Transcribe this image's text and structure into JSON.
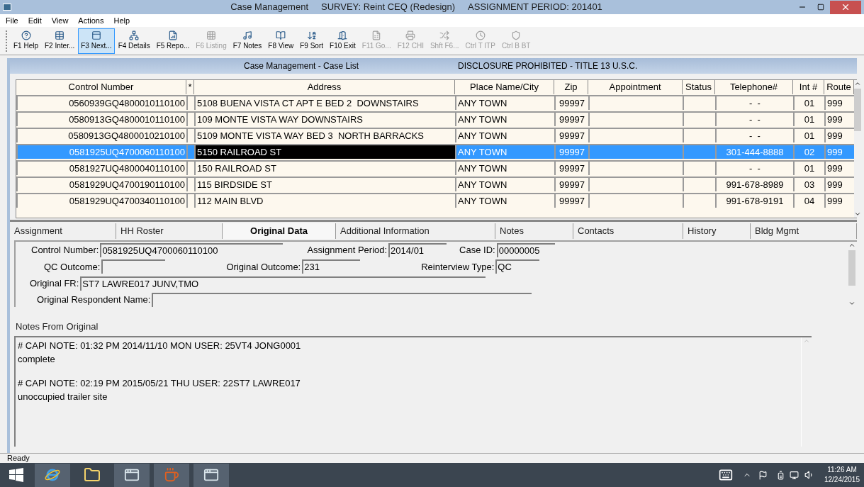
{
  "window": {
    "title_parts": [
      "Case Management",
      "SURVEY: Reint CEQ (Redesign)",
      "ASSIGNMENT PERIOD: 201401"
    ]
  },
  "menu": [
    "File",
    "Edit",
    "View",
    "Actions",
    "Help"
  ],
  "toolbar": [
    {
      "label": "F1 Help",
      "disabled": false,
      "selected": false
    },
    {
      "label": "F2 Inter...",
      "disabled": false,
      "selected": false
    },
    {
      "label": "F3 Next...",
      "disabled": false,
      "selected": true
    },
    {
      "label": "F4 Details",
      "disabled": false,
      "selected": false
    },
    {
      "label": "F5 Repo...",
      "disabled": false,
      "selected": false
    },
    {
      "label": "F6 Listing",
      "disabled": true,
      "selected": false
    },
    {
      "label": "F7 Notes",
      "disabled": false,
      "selected": false
    },
    {
      "label": "F8 View",
      "disabled": false,
      "selected": false
    },
    {
      "label": "F9 Sort",
      "disabled": false,
      "selected": false
    },
    {
      "label": "F10 Exit",
      "disabled": false,
      "selected": false
    },
    {
      "label": "F11 Go...",
      "disabled": true,
      "selected": false
    },
    {
      "label": "F12 CHI",
      "disabled": true,
      "selected": false
    },
    {
      "label": "Shft F6...",
      "disabled": true,
      "selected": false
    },
    {
      "label": "Ctrl T ITP",
      "disabled": true,
      "selected": false
    },
    {
      "label": "Ctrl B BT",
      "disabled": true,
      "selected": false
    }
  ],
  "case_list": {
    "title": "Case Management - Case List",
    "notice": "DISCLOSURE PROHIBITED - TITLE 13 U.S.C.",
    "columns": [
      "Control Number",
      "*",
      "Address",
      "Place Name/City",
      "Zip",
      "Appointment",
      "Status",
      "Telephone#",
      "Int #",
      "Route"
    ],
    "rows": [
      {
        "selected": false,
        "cells": [
          "0560939GQ4800010110100",
          "",
          "5108 BUENA VISTA CT APT E BED 2  DOWNSTAIRS",
          "ANY TOWN",
          "99997",
          "",
          "",
          "-  -",
          "01",
          "999"
        ]
      },
      {
        "selected": false,
        "cells": [
          "0580913GQ4800010110100",
          "",
          "109 MONTE VISTA WAY DOWNSTAIRS",
          "ANY TOWN",
          "99997",
          "",
          "",
          "-  -",
          "01",
          "999"
        ]
      },
      {
        "selected": false,
        "cells": [
          "0580913GQ4800010210100",
          "",
          "5109 MONTE VISTA WAY BED 3  NORTH BARRACKS",
          "ANY TOWN",
          "99997",
          "",
          "",
          "-  -",
          "01",
          "999"
        ]
      },
      {
        "selected": true,
        "cells": [
          "0581925UQ4700060110100",
          "",
          "5150 RAILROAD ST",
          "ANY TOWN",
          "99997",
          "",
          "",
          "301-444-8888",
          "02",
          "999"
        ]
      },
      {
        "selected": false,
        "cells": [
          "0581927UQ4800040110100",
          "",
          "150 RAILROAD ST",
          "ANY TOWN",
          "99997",
          "",
          "",
          "-  -",
          "01",
          "999"
        ]
      },
      {
        "selected": false,
        "cells": [
          "0581929UQ4700190110100",
          "",
          "115 BIRDSIDE ST",
          "ANY TOWN",
          "99997",
          "",
          "",
          "991-678-8989",
          "03",
          "999"
        ]
      },
      {
        "selected": false,
        "cells": [
          "0581929UQ4700340110100",
          "",
          "112 MAIN BLVD",
          "ANY TOWN",
          "99997",
          "",
          "",
          "991-678-9191",
          "04",
          "999"
        ]
      }
    ]
  },
  "tabs": [
    {
      "label": "Assignment",
      "selected": false
    },
    {
      "label": "HH Roster",
      "selected": false
    },
    {
      "label": "Original Data",
      "selected": true
    },
    {
      "label": "Additional Information",
      "selected": false
    },
    {
      "label": "Notes",
      "selected": false
    },
    {
      "label": "Contacts",
      "selected": false
    },
    {
      "label": "History",
      "selected": false
    },
    {
      "label": "Bldg Mgmt",
      "selected": false
    }
  ],
  "form_rows": [
    [
      {
        "label": "Control Number:",
        "value": "0581925UQ4700060110100"
      },
      {
        "label": "Assignment Period:",
        "value": "2014/01"
      },
      {
        "label": "Case ID:",
        "value": "00000005"
      }
    ],
    [
      {
        "label": "QC Outcome:"
      },
      {
        "label": "Original Outcome:",
        "value": "231"
      },
      {
        "label": "Reinterview Type:",
        "value": "QC"
      }
    ],
    [
      {
        "label": "Original FR:",
        "value": "ST7 LAWRE017 JUNV,TMO"
      }
    ],
    [
      {
        "label": "Original Respondent Name:"
      }
    ]
  ],
  "notes_from_original": {
    "label": "Notes From Original",
    "entries": [
      {
        "header": "# CAPI NOTE: 01:32 PM 2014/11/10 MON USER: 25VT4 JONG0001",
        "body": "complete"
      },
      {
        "header": "# CAPI NOTE: 02:19 PM 2015/05/21 THU USER: 22ST7 LAWRE017",
        "body": "unoccupied trailer site"
      }
    ]
  },
  "status_bar": "Ready",
  "taskbar": {
    "time": "11:26 AM",
    "date": "12/24/2015"
  }
}
